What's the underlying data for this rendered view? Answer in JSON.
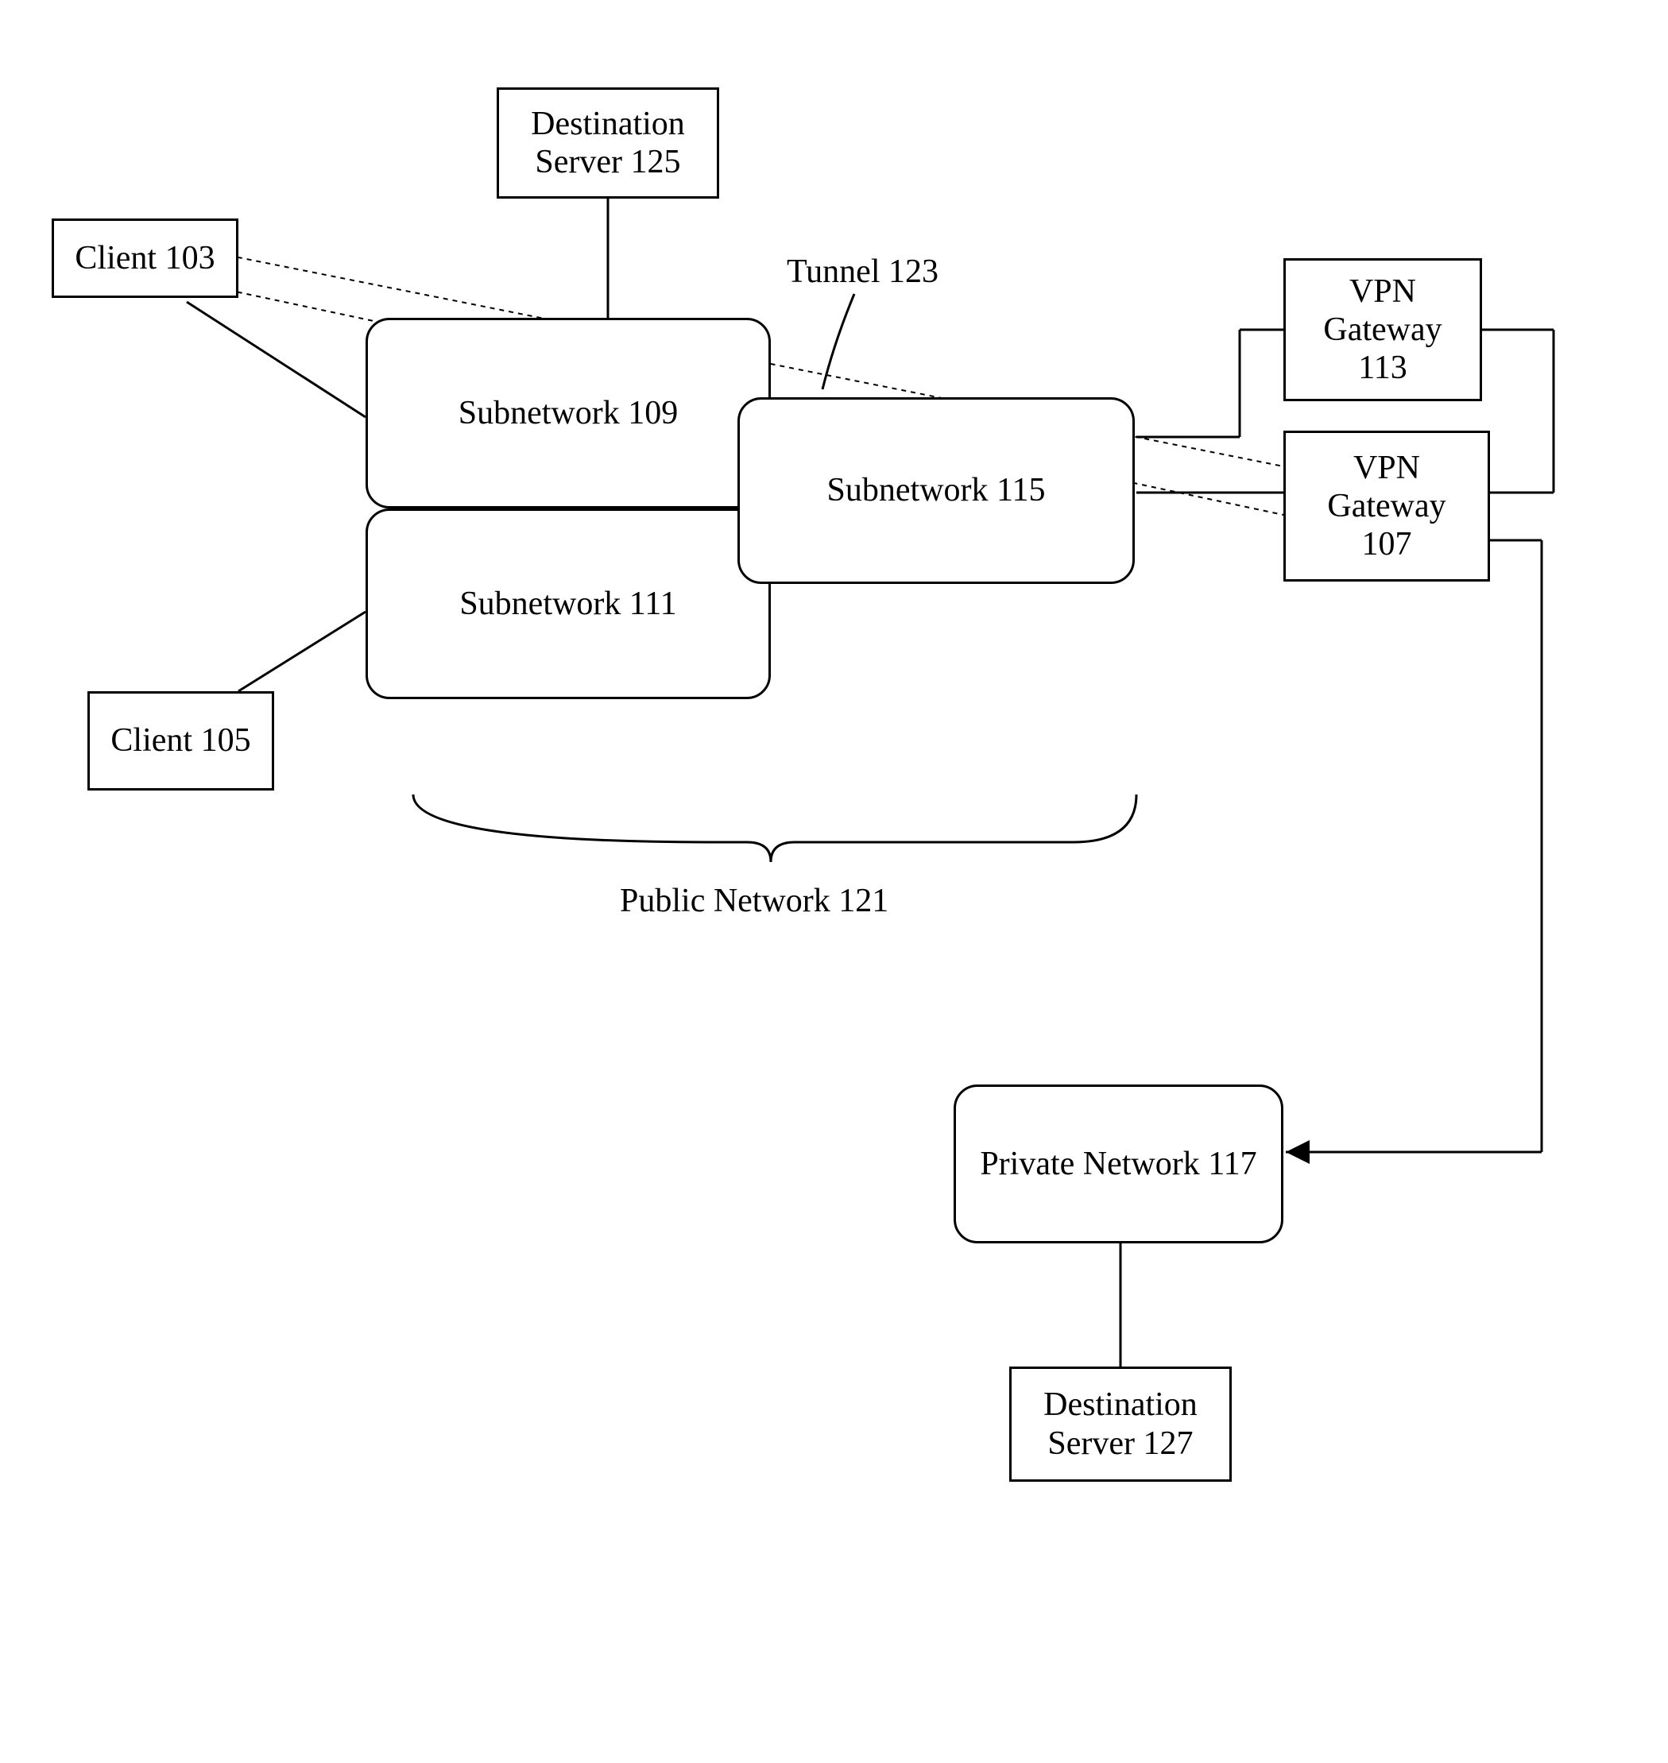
{
  "nodes": {
    "destServer125": {
      "text": "Destination\nServer 125"
    },
    "client103": {
      "text": "Client 103"
    },
    "client105": {
      "text": "Client 105"
    },
    "subnet109": {
      "text": "Subnetwork 109"
    },
    "subnet111": {
      "text": "Subnetwork 111"
    },
    "subnet115": {
      "text": "Subnetwork 115"
    },
    "vpn113": {
      "text": "VPN\nGateway\n113"
    },
    "vpn107": {
      "text": "VPN\nGateway\n107"
    },
    "private117": {
      "text": "Private Network 117"
    },
    "destServer127": {
      "text": "Destination\nServer 127"
    }
  },
  "labels": {
    "tunnel": "Tunnel 123",
    "publicNetwork": "Public Network 121"
  }
}
